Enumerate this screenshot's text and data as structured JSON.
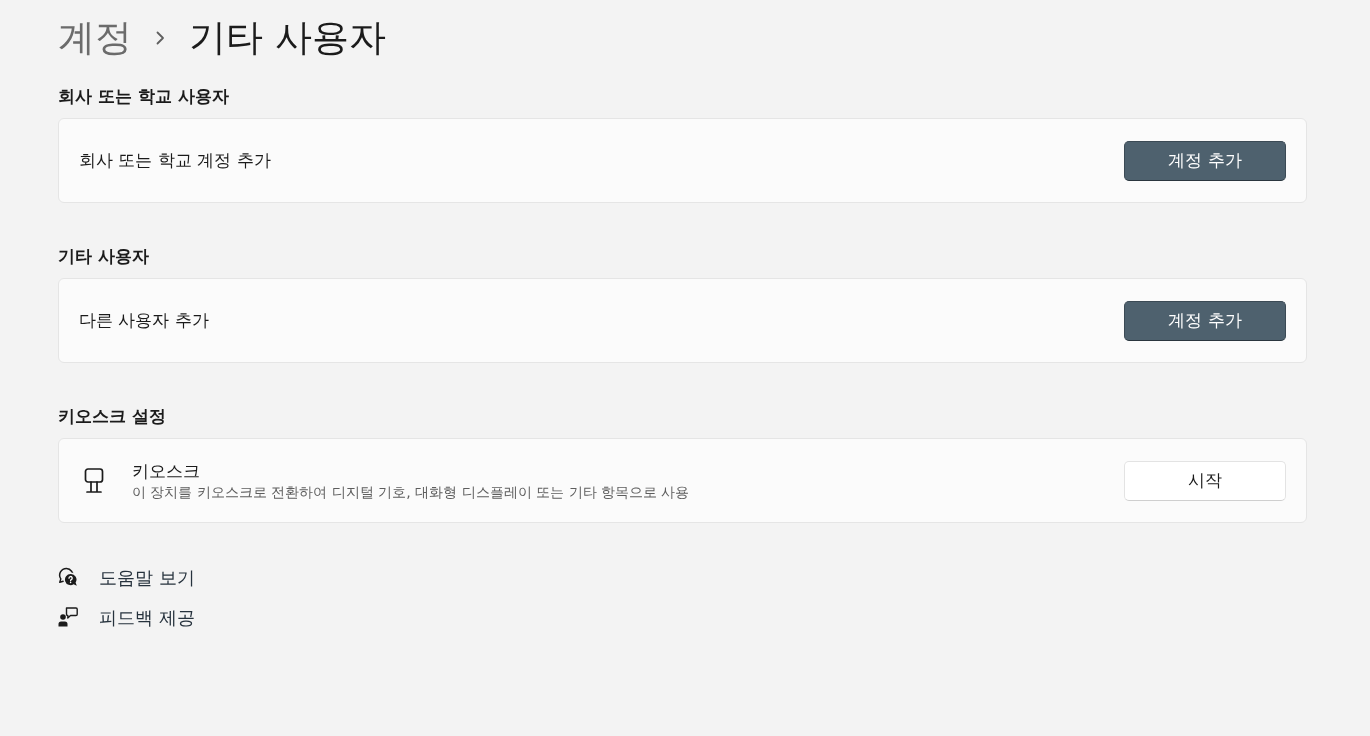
{
  "breadcrumb": [
    {
      "label": "계정",
      "current": false
    },
    {
      "label": "기타 사용자",
      "current": true
    }
  ],
  "sections": [
    {
      "heading": "회사 또는 학교 사용자",
      "card": {
        "kind": "action",
        "label": "회사 또는 학교 계정 추가",
        "button": {
          "label": "계정 추가"
        }
      }
    },
    {
      "heading": "기타 사용자",
      "card": {
        "kind": "action",
        "label": "다른 사용자 추가",
        "button": {
          "label": "계정 추가"
        }
      }
    },
    {
      "heading": "키오스크 설정",
      "card": {
        "kind": "kiosk",
        "label": "키오스크",
        "description": "이 장치를 키오스크로 전환하여 디지털 기호, 대화형 디스플레이 또는 기타 항목으로 사용",
        "button": {
          "label": "시작"
        }
      }
    }
  ],
  "links": [
    {
      "kind": "help",
      "label": "도움말 보기"
    },
    {
      "kind": "feedback",
      "label": "피드백 제공"
    }
  ]
}
